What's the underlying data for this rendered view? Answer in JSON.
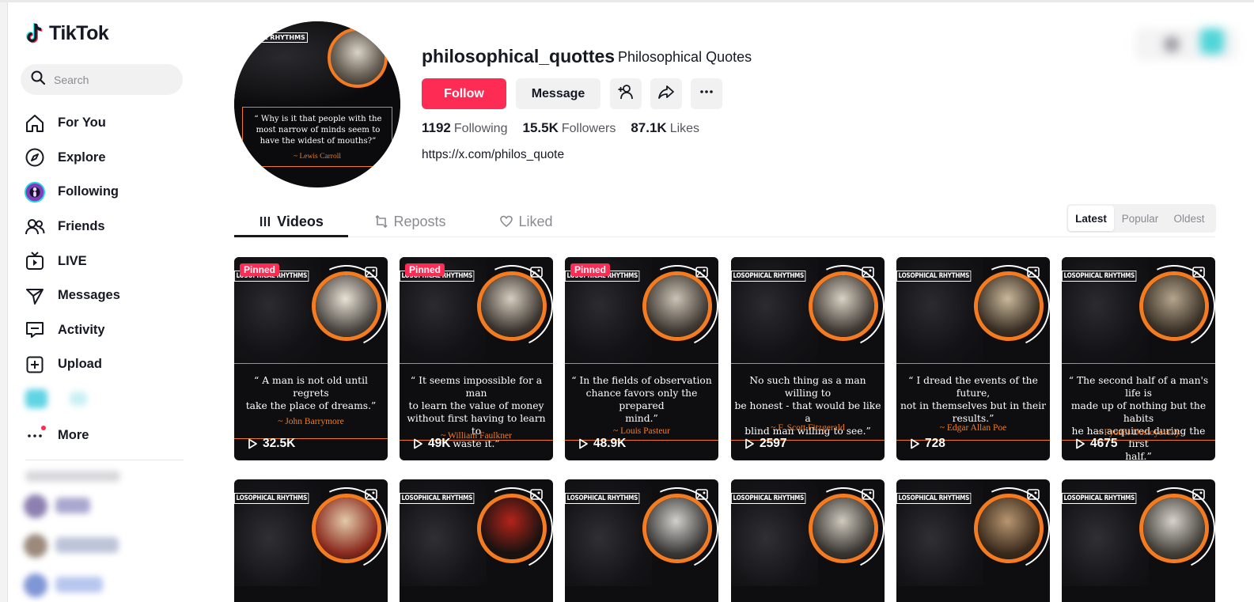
{
  "app": {
    "name": "TikTok"
  },
  "colors": {
    "brand_red": "#fe2c55",
    "accent_orange": "#f47b20"
  },
  "search": {
    "placeholder": "Search"
  },
  "nav": [
    {
      "label": "For You",
      "icon": "home-icon"
    },
    {
      "label": "Explore",
      "icon": "compass-icon"
    },
    {
      "label": "Following",
      "icon": "following-avatar-icon"
    },
    {
      "label": "Friends",
      "icon": "friends-icon"
    },
    {
      "label": "LIVE",
      "icon": "live-tv-icon"
    },
    {
      "label": "Messages",
      "icon": "send-icon"
    },
    {
      "label": "Activity",
      "icon": "activity-icon"
    },
    {
      "label": "Upload",
      "icon": "upload-plus-icon"
    },
    {
      "label": "More",
      "icon": "more-dots-icon"
    }
  ],
  "profile": {
    "username": "philosophical_quottes",
    "nickname": "Philosophical Quotes",
    "follow_label": "Follow",
    "message_label": "Message",
    "following_count": "1192",
    "following_label": "Following",
    "followers_count": "15.5K",
    "followers_label": "Followers",
    "likes_count": "87.1K",
    "likes_label": "Likes",
    "bio_link": "https://x.com/philos_quote",
    "avatar_quote": "“ Why is it that people with the most narrow of minds seem to have the widest of mouths?”",
    "avatar_author": "~ Lewis Carroll",
    "avatar_brand": "OPHICAL RHYTHMS"
  },
  "tabs": [
    {
      "label": "Videos",
      "icon": "grid-bars-icon"
    },
    {
      "label": "Reposts",
      "icon": "repost-icon"
    },
    {
      "label": "Liked",
      "icon": "heart-outline-icon"
    }
  ],
  "sort": {
    "latest": "Latest",
    "popular": "Popular",
    "oldest": "Oldest"
  },
  "brand_text": "LOSOPHICAL RHYTHMS",
  "pinned_label": "Pinned",
  "videos_row1": [
    {
      "pinned": true,
      "quote": "“ A man is not old until regrets\ntake the place of dreams.”",
      "author": "~ John Barrymore",
      "views": "32.5K"
    },
    {
      "pinned": true,
      "quote": "“ It seems impossible for a man\nto learn the value of money\nwithout first having to learn to\nwaste it.”",
      "author": "~ William Faulkner",
      "views": "49K"
    },
    {
      "pinned": true,
      "quote": "“ In the fields of observation\nchance favors only the prepared\nmind.”",
      "author": "~ Louis Pasteur",
      "views": "48.9K"
    },
    {
      "pinned": false,
      "quote": "No such thing as a man willing to\nbe honest - that would be like a\nblind man willing to see.”",
      "author": "~ F. Scott Fitzgerald",
      "views": "2597"
    },
    {
      "pinned": false,
      "quote": "“ I dread the events of the future,\nnot in themselves but in their\nresults.”",
      "author": "~ Edgar Allan Poe",
      "views": "728"
    },
    {
      "pinned": false,
      "quote": "“ The second half of a man's life is\nmade up of nothing but the habits\nhe has acquired during the first\nhalf.”",
      "author": "~ Fyodor Dostoyevsky",
      "views": "4675"
    }
  ]
}
